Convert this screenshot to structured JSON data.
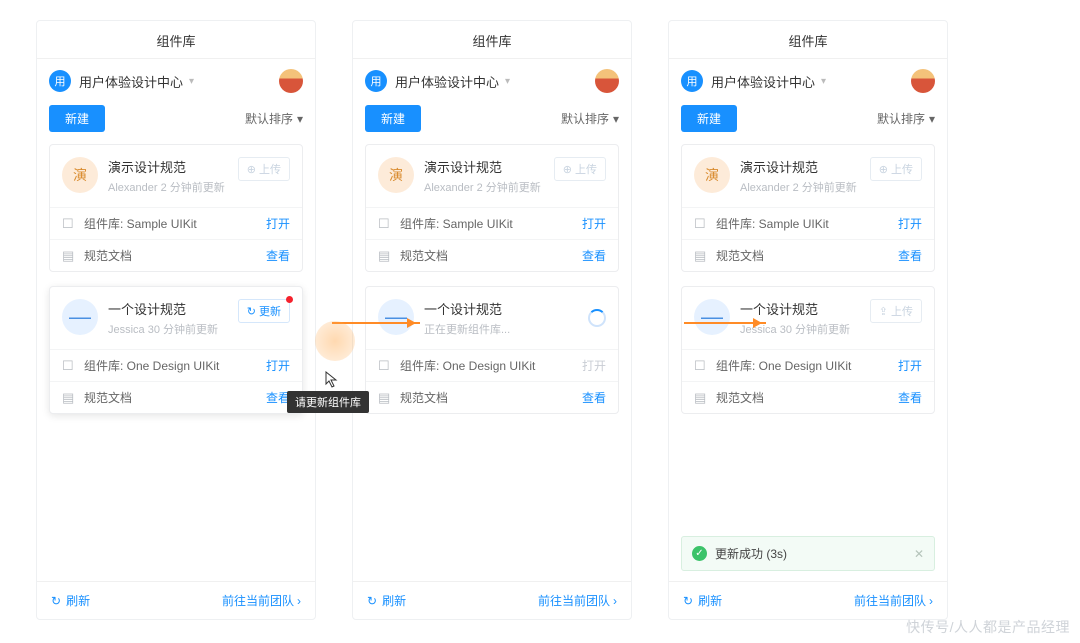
{
  "header_title": "组件库",
  "team": {
    "badge": "用",
    "name": "用户体验设计中心"
  },
  "toolbar": {
    "new_label": "新建",
    "sort_label": "默认排序"
  },
  "footer": {
    "refresh": "刷新",
    "go_team": "前往当前团队"
  },
  "card_a": {
    "icon": "演",
    "title": "演示设计规范",
    "sub": "Alexander 2 分钟前更新",
    "upload": "上传",
    "row1_label": "组件库: Sample UIKit",
    "row1_action": "打开",
    "row2_label": "规范文档",
    "row2_action": "查看"
  },
  "card_b": {
    "title": "一个设计规范",
    "sub_s1": "Jessica 30 分钟前更新",
    "sub_s2": "正在更新组件库...",
    "sub_s3": "Jessica 30 分钟前更新",
    "update_btn": "更新",
    "upload_btn": "上传",
    "row1_label": "组件库: One Design UIKit",
    "open": "打开",
    "row2_label": "规范文档",
    "view": "查看"
  },
  "tooltip": "请更新组件库",
  "toast": "更新成功 (3s)",
  "watermark": "快传号/人人都是产品经理"
}
